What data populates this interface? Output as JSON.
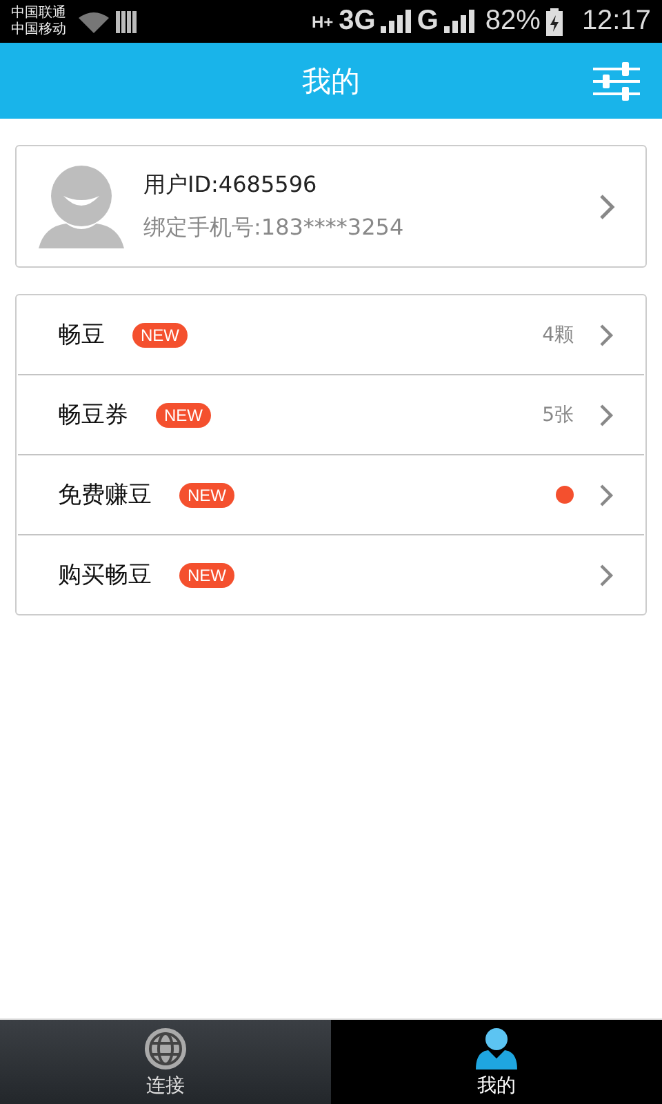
{
  "status_bar": {
    "carriers": [
      "中国联通",
      "中国移动"
    ],
    "network_1": "H+",
    "network_2": "3G",
    "network_3": "G",
    "battery": "82%",
    "time": "12:17"
  },
  "header": {
    "title": "我的"
  },
  "profile": {
    "user_id": "用户ID:4685596",
    "phone": "绑定手机号:183****3254"
  },
  "menu": [
    {
      "label": "畅豆",
      "badge": "NEW",
      "value": "4颗",
      "dot": false
    },
    {
      "label": "畅豆券",
      "badge": "NEW",
      "value": "5张",
      "dot": false
    },
    {
      "label": "免费赚豆",
      "badge": "NEW",
      "dot": true
    },
    {
      "label": "购买畅豆",
      "badge": "NEW",
      "dot": false
    }
  ],
  "tabs": [
    {
      "label": "连接",
      "selected": false,
      "kind": "globe"
    },
    {
      "label": "我的",
      "selected": true,
      "kind": "user"
    }
  ]
}
